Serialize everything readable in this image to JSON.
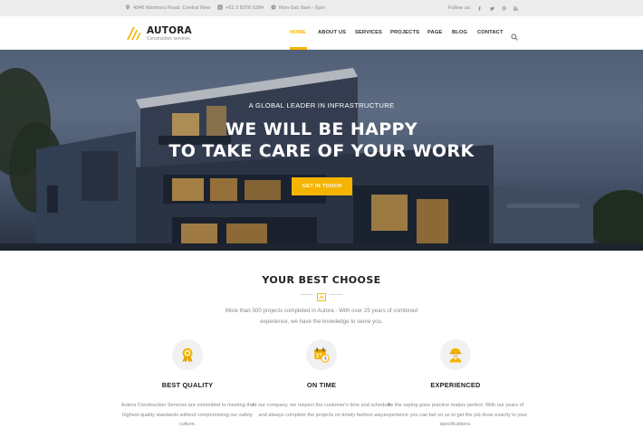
{
  "topbar": {
    "address": "4946 Marmora Road, Central New",
    "phone": "+61 3 8376 6284",
    "hours": "Mon-Sat: 8am - 6pm",
    "follow_label": "Follow us:",
    "socials": [
      "facebook-icon",
      "twitter-icon",
      "pinterest-icon",
      "rss-icon"
    ]
  },
  "header": {
    "logo_name": "AUTORA",
    "logo_tagline": "Construction services",
    "nav": [
      "HOME",
      "ABOUT US",
      "SERVICES",
      "PROJECTS",
      "PAGE",
      "BLOG",
      "CONTACT"
    ],
    "active_nav": "HOME"
  },
  "hero": {
    "kicker": "A GLOBAL LEADER IN INFRASTRUCTURE",
    "title_line1": "WE WILL BE HAPPY",
    "title_line2": "TO TAKE CARE OF YOUR WORK",
    "cta": "GET IN TOUCH"
  },
  "section": {
    "title": "YOUR BEST CHOOSE",
    "description": "More than 500 projects completed in Autora - With over 25 years of combined experience, we have the knowledge to serve you."
  },
  "features": [
    {
      "icon": "medal-icon",
      "title": "BEST QUALITY",
      "text": "Autora Construction Services are committed to meeting the highest quality standards without compromising our safety culture."
    },
    {
      "icon": "calendar-clock-icon",
      "title": "ON TIME",
      "text": "At our company, we respect the customer's time and schedule and always complete the projects on timely fashion way."
    },
    {
      "icon": "worker-icon",
      "title": "EXPERIENCED",
      "text": "As the saying goes practice makes perfect. With our years of experience you can bet on us to get the job done exactly to your specifications."
    }
  ],
  "colors": {
    "accent": "#f5b400",
    "topbar_bg": "#ececec",
    "text_dark": "#222222",
    "text_muted": "#888888"
  }
}
